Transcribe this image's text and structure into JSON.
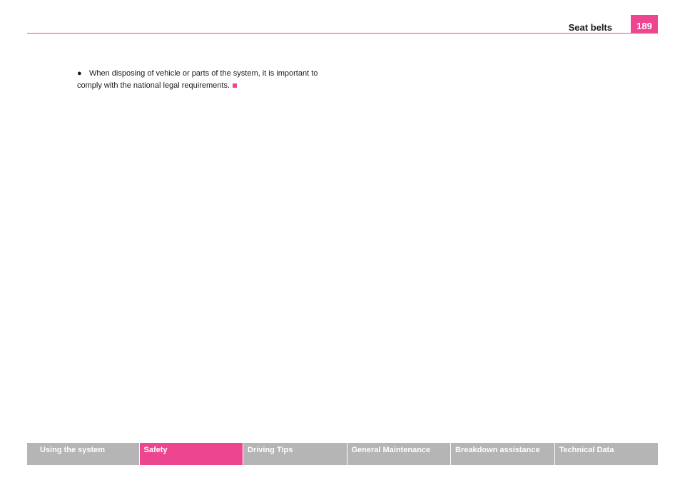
{
  "header": {
    "section_title": "Seat belts",
    "page_number": "189"
  },
  "content": {
    "bullet_line_1": "When disposing of vehicle or parts of the system, it is important to",
    "bullet_line_2": "comply with the national legal requirements."
  },
  "footer_nav": {
    "tabs": [
      {
        "label": "Using the system",
        "active": false
      },
      {
        "label": "Safety",
        "active": true
      },
      {
        "label": "Driving Tips",
        "active": false
      },
      {
        "label": "General Maintenance",
        "active": false
      },
      {
        "label": "Breakdown assistance",
        "active": false
      },
      {
        "label": "Technical Data",
        "active": false
      }
    ]
  },
  "colors": {
    "accent": "#ee4591",
    "tab_inactive": "#b5b5b5",
    "text": "#1a1a1a"
  }
}
